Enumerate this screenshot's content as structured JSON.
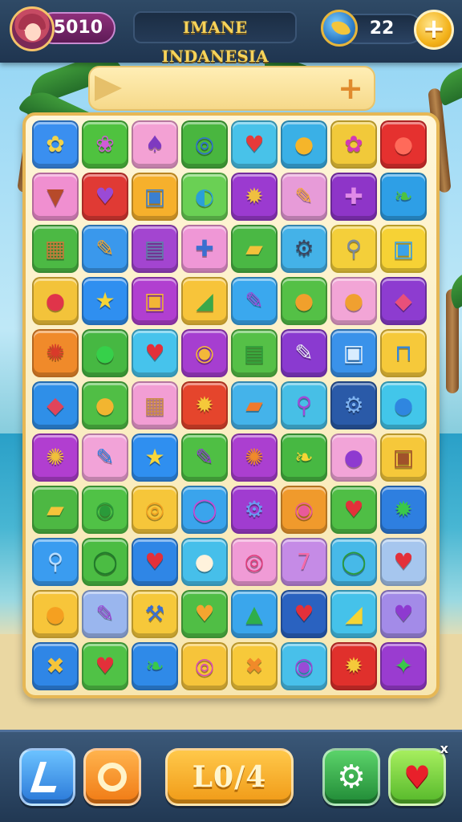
{
  "header": {
    "score": "5010",
    "title": "IMANE INDANESIA",
    "coins": "22",
    "plus_label": "+"
  },
  "progress": {
    "plus_label": "+"
  },
  "board": {
    "rows": [
      [
        {
          "icon": "flower-icon",
          "glyph": "✿",
          "bg": "#3a8ff0",
          "fg": "#f2d34a"
        },
        {
          "icon": "blob-flower-icon",
          "glyph": "❀",
          "bg": "#4fc23f",
          "fg": "#d05bd6"
        },
        {
          "icon": "racket-icon",
          "glyph": "♠",
          "bg": "#f3a1d4",
          "fg": "#7e3ac0"
        },
        {
          "icon": "spool-icon",
          "glyph": "◎",
          "bg": "#49b63f",
          "fg": "#2f6fd0"
        },
        {
          "icon": "heart-icon",
          "glyph": "♥",
          "bg": "#48c2e9",
          "fg": "#e53a3a"
        },
        {
          "icon": "lemon-icon",
          "glyph": "●",
          "bg": "#3ab0e6",
          "fg": "#f5b52a"
        },
        {
          "icon": "flower-icon",
          "glyph": "✿",
          "bg": "#f1c93a",
          "fg": "#d23ab5"
        },
        {
          "icon": "apple-icon",
          "glyph": "●",
          "bg": "#e5312f",
          "fg": "#ff6a5a"
        }
      ],
      [
        {
          "icon": "ice-cream-icon",
          "glyph": "▼",
          "bg": "#f08fd0",
          "fg": "#b74a2a"
        },
        {
          "icon": "heart-icon",
          "glyph": "♥",
          "bg": "#e03a34",
          "fg": "#9a4ad6"
        },
        {
          "icon": "camera-icon",
          "glyph": "▣",
          "bg": "#f6b02c",
          "fg": "#3a7fd0"
        },
        {
          "icon": "leaf-icon",
          "glyph": "◐",
          "bg": "#6ad054",
          "fg": "#2aa0d8"
        },
        {
          "icon": "cookie-icon",
          "glyph": "✹",
          "bg": "#9b3ad0",
          "fg": "#f0c040"
        },
        {
          "icon": "pushpin-icon",
          "glyph": "✎",
          "bg": "#e79bd8",
          "fg": "#f3a53a"
        },
        {
          "icon": "bone-icon",
          "glyph": "✚",
          "bg": "#8e35c8",
          "fg": "#e08ae8"
        },
        {
          "icon": "leaf-icon",
          "glyph": "❧",
          "bg": "#2e9fe6",
          "fg": "#4fc23f"
        }
      ],
      [
        {
          "icon": "crate-icon",
          "glyph": "▦",
          "bg": "#4cb944",
          "fg": "#c77a3a"
        },
        {
          "icon": "pencil-icon",
          "glyph": "✎",
          "bg": "#3a98ec",
          "fg": "#f2a52c"
        },
        {
          "icon": "robot-icon",
          "glyph": "▤",
          "bg": "#a345d0",
          "fg": "#5f7fa8"
        },
        {
          "icon": "syringe-icon",
          "glyph": "✚",
          "bg": "#ef97d6",
          "fg": "#3a6fd0"
        },
        {
          "icon": "cheese-icon",
          "glyph": "▰",
          "bg": "#4ab844",
          "fg": "#f2c23a"
        },
        {
          "icon": "gear-icon",
          "glyph": "⚙",
          "bg": "#44b2e8",
          "fg": "#3a4660"
        },
        {
          "icon": "magnifier-icon",
          "glyph": "⚲",
          "bg": "#f4cf3a",
          "fg": "#7a8aa0"
        },
        {
          "icon": "box-icon",
          "glyph": "▣",
          "bg": "#f6d235",
          "fg": "#3aa2e8"
        }
      ],
      [
        {
          "icon": "ball-icon",
          "glyph": "●",
          "bg": "#f3c33a",
          "fg": "#e0344a"
        },
        {
          "icon": "star-icon",
          "glyph": "★",
          "bg": "#2f8ff0",
          "fg": "#f5d535"
        },
        {
          "icon": "tablet-icon",
          "glyph": "▣",
          "bg": "#b13fd0",
          "fg": "#f2b536"
        },
        {
          "icon": "shard-icon",
          "glyph": "◢",
          "bg": "#f7c43a",
          "fg": "#3aa84a"
        },
        {
          "icon": "pen-icon",
          "glyph": "✎",
          "bg": "#3aa8ee",
          "fg": "#9a4ad6"
        },
        {
          "icon": "onion-icon",
          "glyph": "●",
          "bg": "#54c046",
          "fg": "#f0a02c"
        },
        {
          "icon": "burger-icon",
          "glyph": "●",
          "bg": "#f2a5d6",
          "fg": "#f0a030"
        },
        {
          "icon": "bird-icon",
          "glyph": "◆",
          "bg": "#8d3cd0",
          "fg": "#e9507a"
        }
      ],
      [
        {
          "icon": "carrot-bunch-icon",
          "glyph": "✺",
          "bg": "#f08a2a",
          "fg": "#d93a2a"
        },
        {
          "icon": "bubble-icon",
          "glyph": "●",
          "bg": "#46b842",
          "fg": "#36d04a"
        },
        {
          "icon": "heart-icon",
          "glyph": "♥",
          "bg": "#46c3ec",
          "fg": "#e3303a"
        },
        {
          "icon": "bowl-icon",
          "glyph": "◉",
          "bg": "#a63ed0",
          "fg": "#f2b83a"
        },
        {
          "icon": "coins-stack-icon",
          "glyph": "▤",
          "bg": "#55c047",
          "fg": "#2f9e3a"
        },
        {
          "icon": "eggplant-icon",
          "glyph": "✎",
          "bg": "#8a3ad0",
          "fg": "#e9e9f5"
        },
        {
          "icon": "picture-icon",
          "glyph": "▣",
          "bg": "#3a92ea",
          "fg": "#d9edff"
        },
        {
          "icon": "table-icon",
          "glyph": "⊓",
          "bg": "#f6c93a",
          "fg": "#2f86e0"
        }
      ],
      [
        {
          "icon": "lips-icon",
          "glyph": "◆",
          "bg": "#2f8fe8",
          "fg": "#e0445a"
        },
        {
          "icon": "pepper-icon",
          "glyph": "●",
          "bg": "#50be45",
          "fg": "#f2b530"
        },
        {
          "icon": "logs-icon",
          "glyph": "▦",
          "bg": "#f29ed4",
          "fg": "#c98a4a"
        },
        {
          "icon": "sun-icon",
          "glyph": "✹",
          "bg": "#e5452c",
          "fg": "#f5c93a"
        },
        {
          "icon": "tube-icon",
          "glyph": "▰",
          "bg": "#44b3ea",
          "fg": "#f07a2c"
        },
        {
          "icon": "lollipop-icon",
          "glyph": "⚲",
          "bg": "#47bfe6",
          "fg": "#a04ad6"
        },
        {
          "icon": "gear-icon",
          "glyph": "⚙",
          "bg": "#2a5aa8",
          "fg": "#7fb3f0"
        },
        {
          "icon": "bubble-icon",
          "glyph": "●",
          "bg": "#42c6ea",
          "fg": "#2f86e0"
        }
      ],
      [
        {
          "icon": "palm-leaves-icon",
          "glyph": "✺",
          "bg": "#b13ed0",
          "fg": "#f0c03a"
        },
        {
          "icon": "paintbrush-icon",
          "glyph": "✎",
          "bg": "#f2a3d8",
          "fg": "#2f7fe0"
        },
        {
          "icon": "smiley-star-icon",
          "glyph": "★",
          "bg": "#2f8ff0",
          "fg": "#f8d63a"
        },
        {
          "icon": "crayon-icon",
          "glyph": "✎",
          "bg": "#4fbf44",
          "fg": "#8e3ad0"
        },
        {
          "icon": "carrot-bunch-icon",
          "glyph": "✺",
          "bg": "#ab3fd0",
          "fg": "#f08a2a"
        },
        {
          "icon": "leaf-icon",
          "glyph": "❧",
          "bg": "#47b842",
          "fg": "#f5d535"
        },
        {
          "icon": "orb-icon",
          "glyph": "●",
          "bg": "#f2a4d8",
          "fg": "#8e3ad0"
        },
        {
          "icon": "camera-icon",
          "glyph": "▣",
          "bg": "#f6c83a",
          "fg": "#a0522a"
        }
      ],
      [
        {
          "icon": "scroll-icon",
          "glyph": "▰",
          "bg": "#4db843",
          "fg": "#f5c43a"
        },
        {
          "icon": "snail-icon",
          "glyph": "◉",
          "bg": "#50c246",
          "fg": "#2a9a3a"
        },
        {
          "icon": "coin-icon",
          "glyph": "◎",
          "bg": "#f6c63a",
          "fg": "#f0a020"
        },
        {
          "icon": "ring-icon",
          "glyph": "◯",
          "bg": "#3aa4ec",
          "fg": "#c64ad6"
        },
        {
          "icon": "gear-icon",
          "glyph": "⚙",
          "bg": "#a03cd0",
          "fg": "#6a9af0"
        },
        {
          "icon": "donut-icon",
          "glyph": "◉",
          "bg": "#f09a2c",
          "fg": "#e85a9a"
        },
        {
          "icon": "heart-icon",
          "glyph": "♥",
          "bg": "#4fbe45",
          "fg": "#e3303a"
        },
        {
          "icon": "splat-icon",
          "glyph": "✹",
          "bg": "#2e7fe0",
          "fg": "#3ac84a"
        }
      ],
      [
        {
          "icon": "magnifier-icon",
          "glyph": "⚲",
          "bg": "#3a9cf0",
          "fg": "#b9ddff"
        },
        {
          "icon": "speech-bubble-icon",
          "glyph": "◯",
          "bg": "#4bbc43",
          "fg": "#1f7a2a"
        },
        {
          "icon": "heart-icon",
          "glyph": "♥",
          "bg": "#2f86e6",
          "fg": "#e3303a"
        },
        {
          "icon": "dumpling-icon",
          "glyph": "●",
          "bg": "#46bfea",
          "fg": "#fff2dc"
        },
        {
          "icon": "swirl-icon",
          "glyph": "◎",
          "bg": "#f09bd6",
          "fg": "#e03a7a"
        },
        {
          "icon": "number-seven-icon",
          "glyph": "7",
          "bg": "#c58be6",
          "fg": "#f56aa8"
        },
        {
          "icon": "speech-bubble-icon",
          "glyph": "◯",
          "bg": "#47b9e8",
          "fg": "#2a9a3a"
        },
        {
          "icon": "heart-icon",
          "glyph": "♥",
          "bg": "#a6c6ee",
          "fg": "#e3303a"
        }
      ],
      [
        {
          "icon": "smiley-blob-icon",
          "glyph": "●",
          "bg": "#f7c53a",
          "fg": "#f5a020"
        },
        {
          "icon": "crayon-icon",
          "glyph": "✎",
          "bg": "#9ab6ee",
          "fg": "#9a4ad6"
        },
        {
          "icon": "pickaxe-icon",
          "glyph": "⚒",
          "bg": "#f6c83a",
          "fg": "#3a6fd0"
        },
        {
          "icon": "heart-icon",
          "glyph": "♥",
          "bg": "#50be45",
          "fg": "#f5a530"
        },
        {
          "icon": "tree-icon",
          "glyph": "▲",
          "bg": "#3aa6ec",
          "fg": "#2fae4a"
        },
        {
          "icon": "heart-icon",
          "glyph": "♥",
          "bg": "#2a62c0",
          "fg": "#e3303a"
        },
        {
          "icon": "shoe-icon",
          "glyph": "◢",
          "bg": "#45c2ea",
          "fg": "#f5d535"
        },
        {
          "icon": "heart-icon",
          "glyph": "♥",
          "bg": "#a38be8",
          "fg": "#8e3ad0"
        }
      ],
      [
        {
          "icon": "bow-icon",
          "glyph": "✖",
          "bg": "#2f86e6",
          "fg": "#f5c43a"
        },
        {
          "icon": "strawberry-icon",
          "glyph": "♥",
          "bg": "#50c246",
          "fg": "#e3303a"
        },
        {
          "icon": "leaf-icon",
          "glyph": "❧",
          "bg": "#2f8ae8",
          "fg": "#3ac84a"
        },
        {
          "icon": "target-icon",
          "glyph": "◎",
          "bg": "#f6c43a",
          "fg": "#d94ab8"
        },
        {
          "icon": "crossed-sticks-icon",
          "glyph": "✖",
          "bg": "#f7c93a",
          "fg": "#f08a2a"
        },
        {
          "icon": "bottle-icon",
          "glyph": "◉",
          "bg": "#48c0ea",
          "fg": "#9a4ad6"
        },
        {
          "icon": "star-burst-icon",
          "glyph": "✹",
          "bg": "#e0302c",
          "fg": "#f5c93a"
        },
        {
          "icon": "star-icon",
          "glyph": "✦",
          "bg": "#9a3cd0",
          "fg": "#3ac84a"
        }
      ]
    ]
  },
  "toolbar": {
    "center_label": "L0/4",
    "settings_glyph": "⚙",
    "heart_glyph": "♥",
    "close_glyph": "x"
  },
  "colors": {
    "topbar": "#1f3550",
    "board_frame": "#e6b755",
    "title_text": "#f6d35a"
  }
}
